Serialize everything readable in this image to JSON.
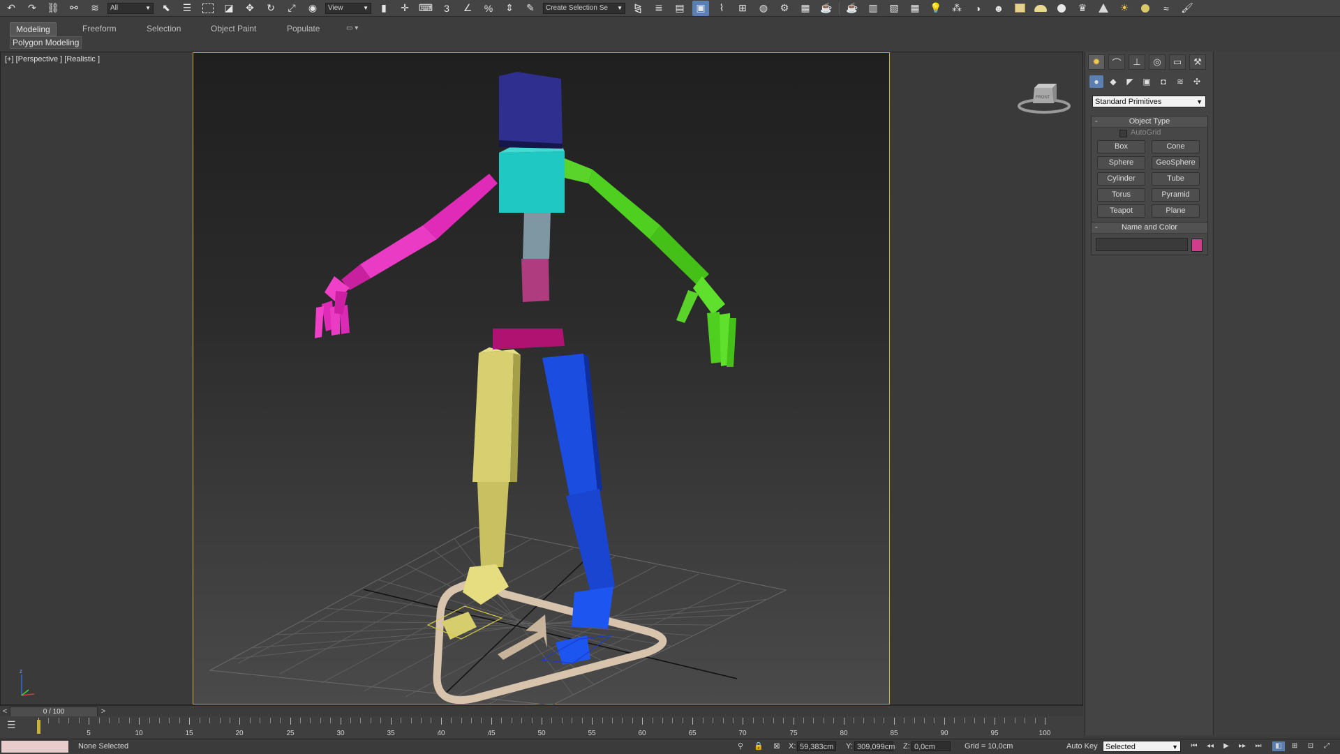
{
  "toolbar": {
    "selection_filter": "All",
    "ref_coord": "View",
    "named_selection": "Create Selection Se",
    "snap_label": "3",
    "percent_snap_label": "%"
  },
  "ribbon": {
    "tabs": [
      "Modeling",
      "Freeform",
      "Selection",
      "Object Paint",
      "Populate"
    ],
    "active_tab": "Modeling",
    "sub_label": "Polygon Modeling"
  },
  "viewport": {
    "label": "[+] [Perspective ] [Realistic ]",
    "viewcube_text": "FRONT"
  },
  "command_panel": {
    "dropdown": "Standard Primitives",
    "object_type": {
      "title": "Object Type",
      "autogrid": "AutoGrid",
      "buttons": [
        "Box",
        "Cone",
        "Sphere",
        "GeoSphere",
        "Cylinder",
        "Tube",
        "Torus",
        "Pyramid",
        "Teapot",
        "Plane"
      ]
    },
    "name_and_color": {
      "title": "Name and Color",
      "name_value": "",
      "color": "#d23c8c"
    }
  },
  "timeline": {
    "frame_display": "0 / 100",
    "prev": "<",
    "next": ">",
    "tick_labels": [
      "0",
      "5",
      "10",
      "15",
      "20",
      "25",
      "30",
      "35",
      "40",
      "45",
      "50",
      "55",
      "60",
      "65",
      "70",
      "75",
      "80",
      "85",
      "90",
      "95",
      "100"
    ]
  },
  "status_bar": {
    "selection_status": "None Selected",
    "x_label": "X:",
    "x_value": "59,383cm",
    "y_label": "Y:",
    "y_value": "309,099cm",
    "z_label": "Z:",
    "z_value": "0,0cm",
    "grid": "Grid = 10,0cm",
    "auto_key": "Auto Key",
    "key_mode": "Selected"
  },
  "colors": {
    "head": "#2e2f8f",
    "chest": "#1fc8c2",
    "spine": "#7f97a3",
    "pelvis_top": "#b03c80",
    "pelvis": "#b01272",
    "left_arm": "#e02ab8",
    "right_arm": "#4fd020",
    "left_leg": "#d8d070",
    "right_leg": "#1a40d8",
    "selection_frame": "#c8b43a",
    "accent": "#5b7fb0"
  }
}
